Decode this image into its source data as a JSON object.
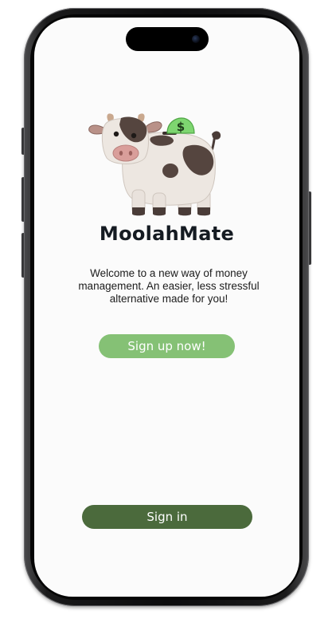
{
  "app": {
    "title": "MoolahMate",
    "welcome_message": "Welcome to a new way of money management. An easier, less stressful alternative made for you!",
    "signup_label": "Sign up now!",
    "signin_label": "Sign in"
  },
  "mascot": {
    "icon": "cow-piggy-bank-icon",
    "coin_symbol": "$"
  },
  "colors": {
    "signup_button": "#85c175",
    "signin_button": "#4b6a3c",
    "title_text": "#151b22",
    "screen_background": "#fbfbfb"
  }
}
